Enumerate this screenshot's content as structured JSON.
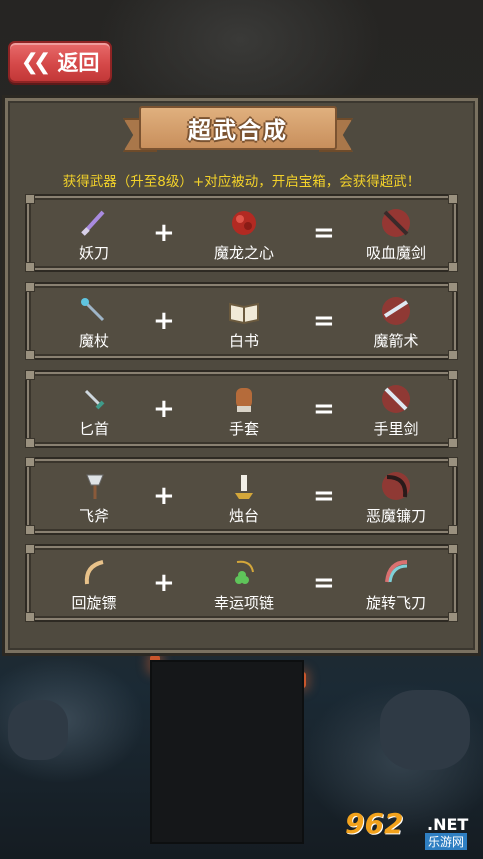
{
  "back_button": {
    "label": "返回"
  },
  "title": "超武合成",
  "subtitle": "获得武器（升至8级）+对应被动，开启宝箱，会获得超武！",
  "plus": "+",
  "equals": "=",
  "recipes": [
    {
      "weapon": "妖刀",
      "passive": "魔龙之心",
      "result": "吸血魔剑"
    },
    {
      "weapon": "魔杖",
      "passive": "白书",
      "result": "魔箭术"
    },
    {
      "weapon": "匕首",
      "passive": "手套",
      "result": "手里剑"
    },
    {
      "weapon": "飞斧",
      "passive": "烛台",
      "result": "恶魔镰刀"
    },
    {
      "weapon": "回旋镖",
      "passive": "幸运项链",
      "result": "旋转飞刀"
    }
  ],
  "watermark": {
    "logo": "962",
    "tld": ".NET",
    "cn": "乐游网"
  },
  "colors": {
    "accent": "#f3d22a",
    "back_button": "#d54949",
    "ribbon": "#c88f5c"
  }
}
